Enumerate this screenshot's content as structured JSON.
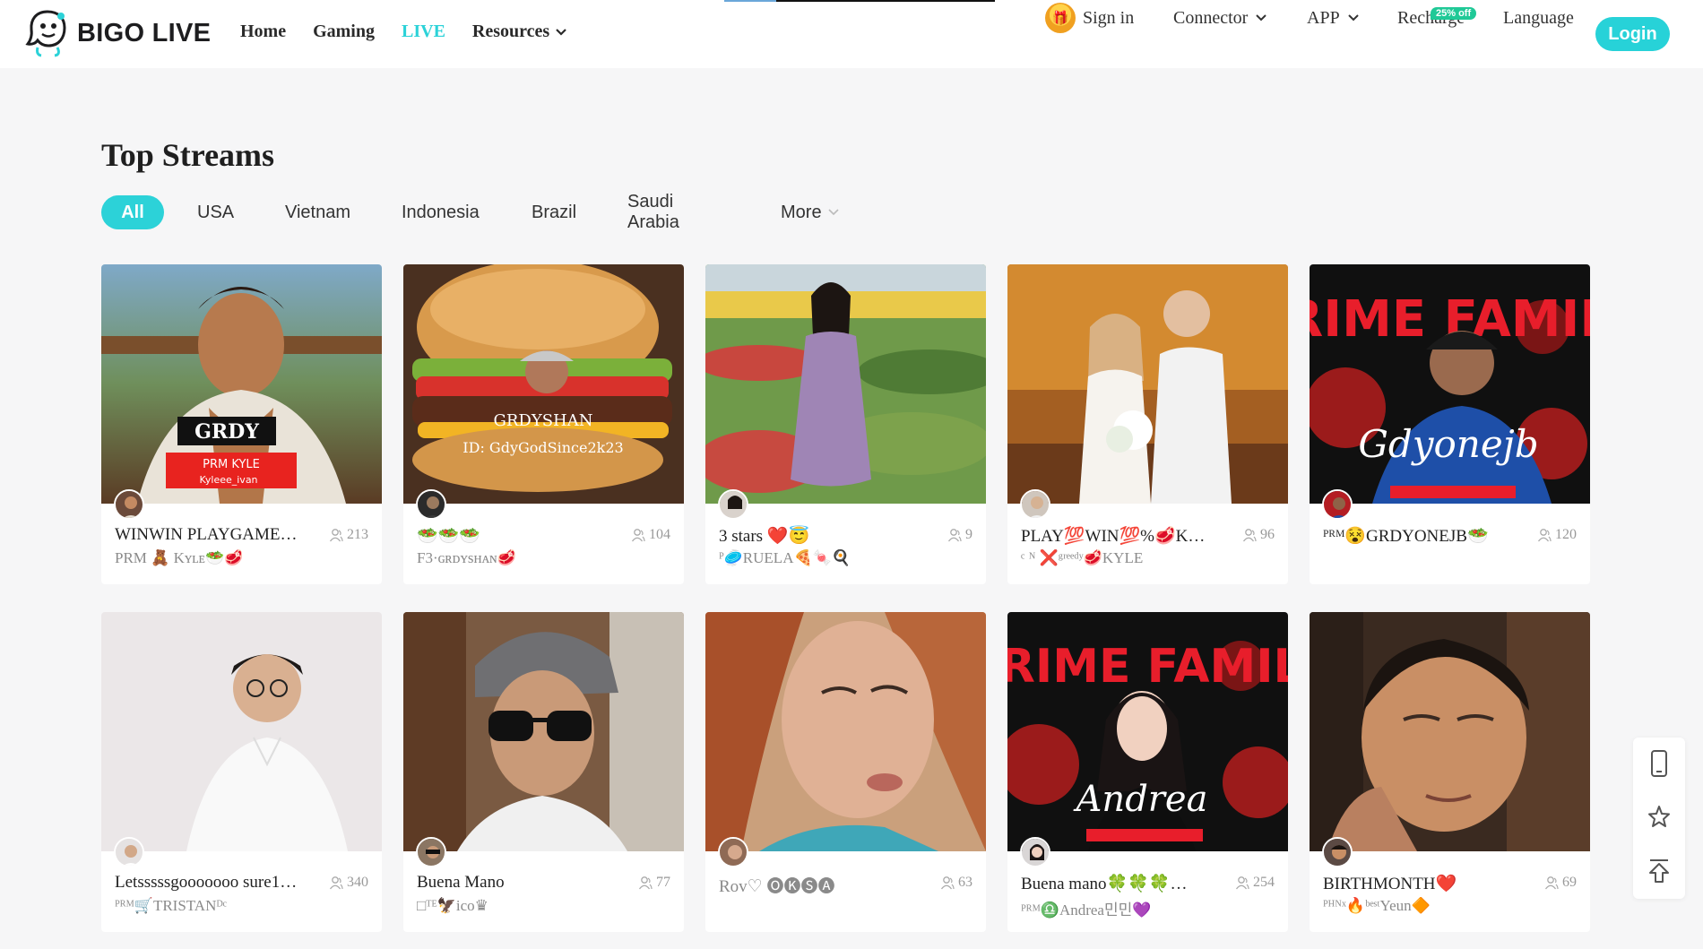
{
  "header": {
    "brand": "BIGO LIVE",
    "nav": [
      {
        "label": "Home",
        "active": false
      },
      {
        "label": "Gaming",
        "active": false
      },
      {
        "label": "LIVE",
        "active": true
      },
      {
        "label": "Resources",
        "active": false,
        "dropdown": true
      }
    ],
    "sign_in": "Sign in",
    "connector": "Connector",
    "app": "APP",
    "recharge": "Recharge",
    "recharge_badge": "25% off",
    "language": "Language",
    "login": "Login"
  },
  "main": {
    "title": "Top Streams",
    "tabs": [
      {
        "label": "All",
        "active": true
      },
      {
        "label": "USA"
      },
      {
        "label": "Vietnam"
      },
      {
        "label": "Indonesia"
      },
      {
        "label": "Brazil"
      },
      {
        "label": "Saudi Arabia"
      },
      {
        "label": "More",
        "dropdown": true
      }
    ],
    "streams": [
      {
        "title": "WINWIN PLAYGAME…",
        "viewers": "213",
        "sub": "PRM 🧸 Kʏʟᴇ🥗🥩"
      },
      {
        "title": "🥗🥗🥗",
        "viewers": "104",
        "sub": "F3·ɢʀᴅʏsʜᴀɴ🥩",
        "overlay": "GRDYSHAN",
        "overlay_sub": "ID: GdyGodSince2k23"
      },
      {
        "title": "3 stars ❤️😇",
        "viewers": "9",
        "sub": "ᴾ🥏RUELA🍕🍬🍳"
      },
      {
        "title": "PLAY💯WIN💯%🥩K…",
        "viewers": "96",
        "sub": "ᶜ ᴺ ❌ᵍʳᵉᵉᵈʸ🥩KYLE"
      },
      {
        "title": "ᴾᴿᴹ😵GRDYONEJB🥗",
        "viewers": "120",
        "sub": "",
        "overlay": "PRIME FAMILY",
        "overlay_sub": "Gdyonejb"
      },
      {
        "title": "Letsssssgooooooo sure1…",
        "viewers": "340",
        "sub": "ᴾᴿᴹ🛒TRISTANᴰᶜ"
      },
      {
        "title": "Buena Mano",
        "viewers": "77",
        "sub": "□ᵀᴱ🦅ico♛"
      },
      {
        "title": "Rov♡ 🅞🅚🅢🅐",
        "viewers": "63",
        "sub": ""
      },
      {
        "title": "Buena mano🍀🍀🍀…",
        "viewers": "254",
        "sub": "ᴾᴿᴹ♎Andrea민민💜",
        "overlay": "PRIME FAMILY",
        "overlay_sub": "Andrea"
      },
      {
        "title": "BIRTHMONTH❤️",
        "viewers": "69",
        "sub": "ᴾᴴᴺˣ🔥ᵇᵉˢᵗYeun🔶"
      }
    ]
  },
  "colors": {
    "accent": "#2cd2d8",
    "badge": "#20c997"
  }
}
